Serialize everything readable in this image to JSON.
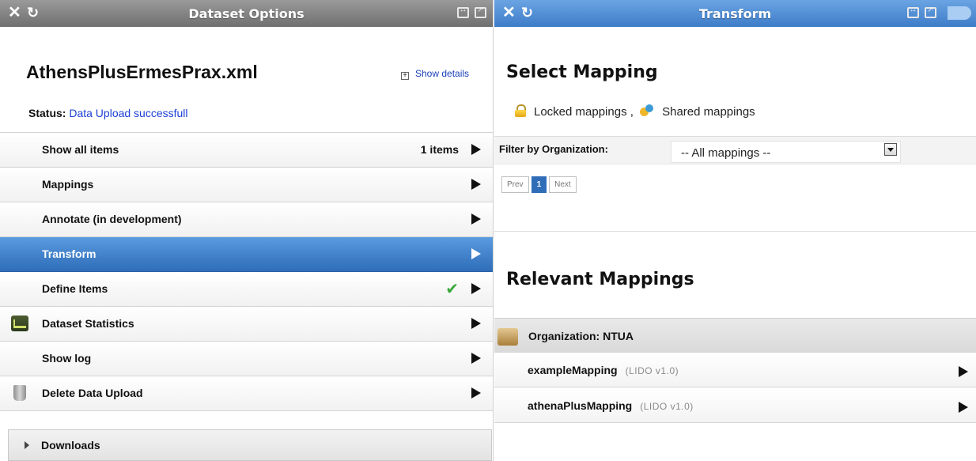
{
  "left_panel": {
    "title": "Dataset Options",
    "dataset_name": "AthensPlusErmesPrax.xml",
    "show_details": "Show details",
    "status_label": "Status:",
    "status_value": "Data Upload successfull",
    "menu": [
      {
        "label": "Show all items",
        "count": "1 items"
      },
      {
        "label": "Mappings"
      },
      {
        "label": "Annotate (in development)"
      },
      {
        "label": "Transform",
        "active": true
      },
      {
        "label": "Define Items",
        "check": "✔"
      },
      {
        "label": "Dataset Statistics",
        "icon": "statistics-icon"
      },
      {
        "label": "Show log"
      },
      {
        "label": "Delete Data Upload",
        "icon": "trash-icon"
      }
    ],
    "downloads_label": "Downloads"
  },
  "right_panel": {
    "title": "Transform",
    "select_heading": "Select Mapping",
    "legend": {
      "locked": "Locked mappings ,",
      "shared": "Shared mappings"
    },
    "filter_label": "Filter by Organization:",
    "filter_value": "-- All mappings --",
    "pager": {
      "prev": "Prev",
      "current": "1",
      "next": "Next"
    },
    "relevant_heading": "Relevant Mappings",
    "organization": "Organization: NTUA",
    "mappings": [
      {
        "name": "exampleMapping",
        "version": "(LIDO v1.0)"
      },
      {
        "name": "athenaPlusMapping",
        "version": "(LIDO v1.0)"
      }
    ]
  },
  "colors": {
    "accent": "#2f6db8",
    "titlebar_grey": "#808080",
    "titlebar_blue": "#4f8fd6",
    "status_link": "#1b3fd6"
  },
  "icons": [
    "close-icon",
    "refresh-icon",
    "expand-icon",
    "popout-icon",
    "lock-icon",
    "share-icon",
    "statistics-icon",
    "trash-icon",
    "organization-icon",
    "check-icon",
    "chevron-right-icon"
  ]
}
